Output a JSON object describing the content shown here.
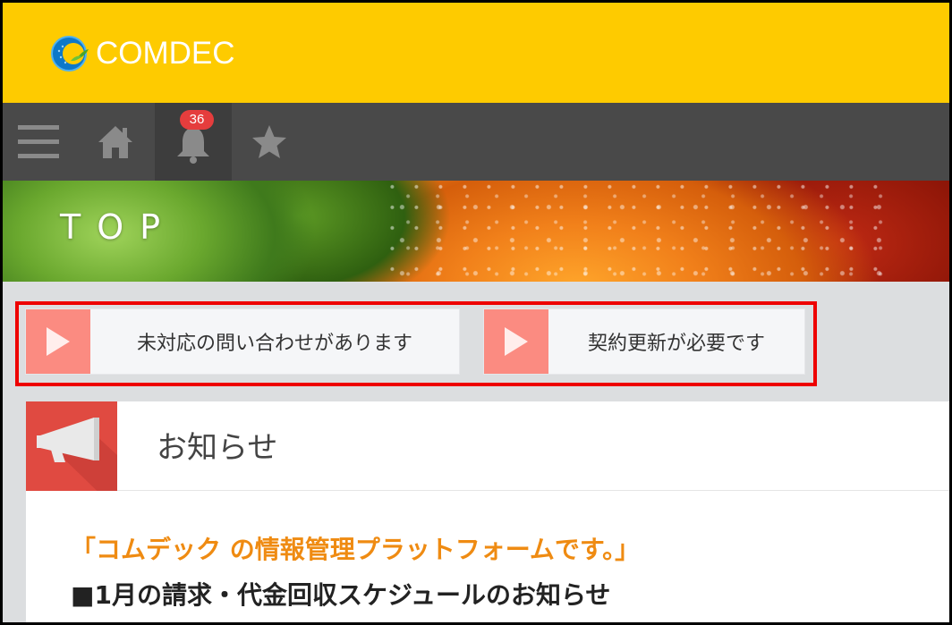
{
  "header": {
    "logo_text": "COMDEC",
    "background_color": "#fecb00"
  },
  "navbar": {
    "items": [
      {
        "name": "menu",
        "icon": "hamburger-menu-icon"
      },
      {
        "name": "home",
        "icon": "home-icon"
      },
      {
        "name": "notifications",
        "icon": "bell-icon",
        "badge": "36"
      },
      {
        "name": "favorites",
        "icon": "star-icon"
      }
    ],
    "background_color": "#494949"
  },
  "banner": {
    "title": "TOP"
  },
  "alerts": [
    {
      "label": "未対応の問い合わせがあります",
      "icon": "play-triangle-icon"
    },
    {
      "label": "契約更新が必要です",
      "icon": "play-triangle-icon"
    }
  ],
  "notice": {
    "title": "お知らせ",
    "icon": "megaphone-icon",
    "line1": "「コムデック の情報管理プラットフォームです。」",
    "line2": "■1月の請求・代金回収スケジュールのお知らせ"
  },
  "colors": {
    "alert_icon_bg": "#fb8b81",
    "highlight_border": "#ee0000",
    "notice_icon_bg": "#e04a41",
    "notice_accent": "#ef8b12"
  }
}
